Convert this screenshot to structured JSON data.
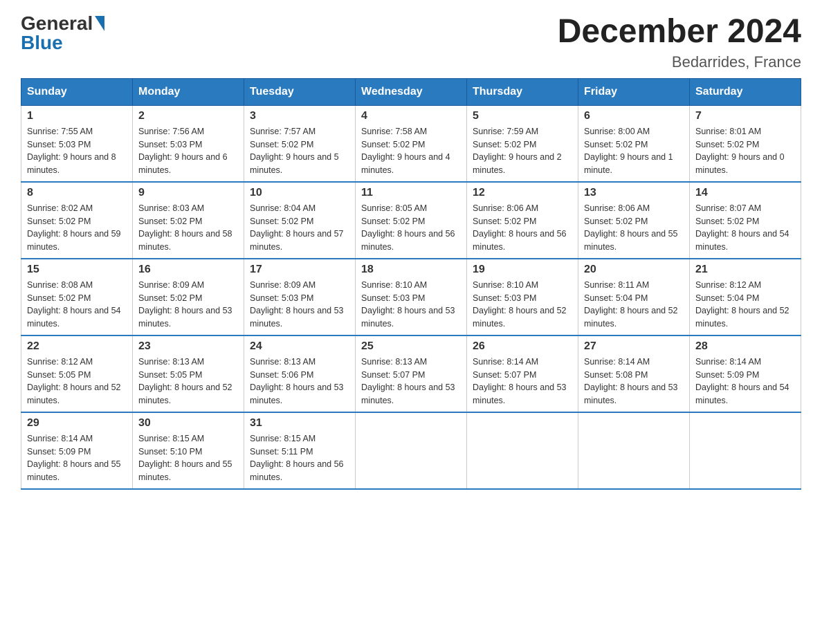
{
  "header": {
    "logo_general": "General",
    "logo_blue": "Blue",
    "month_title": "December 2024",
    "location": "Bedarrides, France"
  },
  "weekdays": [
    "Sunday",
    "Monday",
    "Tuesday",
    "Wednesday",
    "Thursday",
    "Friday",
    "Saturday"
  ],
  "weeks": [
    [
      {
        "day": "1",
        "sunrise": "Sunrise: 7:55 AM",
        "sunset": "Sunset: 5:03 PM",
        "daylight": "Daylight: 9 hours and 8 minutes."
      },
      {
        "day": "2",
        "sunrise": "Sunrise: 7:56 AM",
        "sunset": "Sunset: 5:03 PM",
        "daylight": "Daylight: 9 hours and 6 minutes."
      },
      {
        "day": "3",
        "sunrise": "Sunrise: 7:57 AM",
        "sunset": "Sunset: 5:02 PM",
        "daylight": "Daylight: 9 hours and 5 minutes."
      },
      {
        "day": "4",
        "sunrise": "Sunrise: 7:58 AM",
        "sunset": "Sunset: 5:02 PM",
        "daylight": "Daylight: 9 hours and 4 minutes."
      },
      {
        "day": "5",
        "sunrise": "Sunrise: 7:59 AM",
        "sunset": "Sunset: 5:02 PM",
        "daylight": "Daylight: 9 hours and 2 minutes."
      },
      {
        "day": "6",
        "sunrise": "Sunrise: 8:00 AM",
        "sunset": "Sunset: 5:02 PM",
        "daylight": "Daylight: 9 hours and 1 minute."
      },
      {
        "day": "7",
        "sunrise": "Sunrise: 8:01 AM",
        "sunset": "Sunset: 5:02 PM",
        "daylight": "Daylight: 9 hours and 0 minutes."
      }
    ],
    [
      {
        "day": "8",
        "sunrise": "Sunrise: 8:02 AM",
        "sunset": "Sunset: 5:02 PM",
        "daylight": "Daylight: 8 hours and 59 minutes."
      },
      {
        "day": "9",
        "sunrise": "Sunrise: 8:03 AM",
        "sunset": "Sunset: 5:02 PM",
        "daylight": "Daylight: 8 hours and 58 minutes."
      },
      {
        "day": "10",
        "sunrise": "Sunrise: 8:04 AM",
        "sunset": "Sunset: 5:02 PM",
        "daylight": "Daylight: 8 hours and 57 minutes."
      },
      {
        "day": "11",
        "sunrise": "Sunrise: 8:05 AM",
        "sunset": "Sunset: 5:02 PM",
        "daylight": "Daylight: 8 hours and 56 minutes."
      },
      {
        "day": "12",
        "sunrise": "Sunrise: 8:06 AM",
        "sunset": "Sunset: 5:02 PM",
        "daylight": "Daylight: 8 hours and 56 minutes."
      },
      {
        "day": "13",
        "sunrise": "Sunrise: 8:06 AM",
        "sunset": "Sunset: 5:02 PM",
        "daylight": "Daylight: 8 hours and 55 minutes."
      },
      {
        "day": "14",
        "sunrise": "Sunrise: 8:07 AM",
        "sunset": "Sunset: 5:02 PM",
        "daylight": "Daylight: 8 hours and 54 minutes."
      }
    ],
    [
      {
        "day": "15",
        "sunrise": "Sunrise: 8:08 AM",
        "sunset": "Sunset: 5:02 PM",
        "daylight": "Daylight: 8 hours and 54 minutes."
      },
      {
        "day": "16",
        "sunrise": "Sunrise: 8:09 AM",
        "sunset": "Sunset: 5:02 PM",
        "daylight": "Daylight: 8 hours and 53 minutes."
      },
      {
        "day": "17",
        "sunrise": "Sunrise: 8:09 AM",
        "sunset": "Sunset: 5:03 PM",
        "daylight": "Daylight: 8 hours and 53 minutes."
      },
      {
        "day": "18",
        "sunrise": "Sunrise: 8:10 AM",
        "sunset": "Sunset: 5:03 PM",
        "daylight": "Daylight: 8 hours and 53 minutes."
      },
      {
        "day": "19",
        "sunrise": "Sunrise: 8:10 AM",
        "sunset": "Sunset: 5:03 PM",
        "daylight": "Daylight: 8 hours and 52 minutes."
      },
      {
        "day": "20",
        "sunrise": "Sunrise: 8:11 AM",
        "sunset": "Sunset: 5:04 PM",
        "daylight": "Daylight: 8 hours and 52 minutes."
      },
      {
        "day": "21",
        "sunrise": "Sunrise: 8:12 AM",
        "sunset": "Sunset: 5:04 PM",
        "daylight": "Daylight: 8 hours and 52 minutes."
      }
    ],
    [
      {
        "day": "22",
        "sunrise": "Sunrise: 8:12 AM",
        "sunset": "Sunset: 5:05 PM",
        "daylight": "Daylight: 8 hours and 52 minutes."
      },
      {
        "day": "23",
        "sunrise": "Sunrise: 8:13 AM",
        "sunset": "Sunset: 5:05 PM",
        "daylight": "Daylight: 8 hours and 52 minutes."
      },
      {
        "day": "24",
        "sunrise": "Sunrise: 8:13 AM",
        "sunset": "Sunset: 5:06 PM",
        "daylight": "Daylight: 8 hours and 53 minutes."
      },
      {
        "day": "25",
        "sunrise": "Sunrise: 8:13 AM",
        "sunset": "Sunset: 5:07 PM",
        "daylight": "Daylight: 8 hours and 53 minutes."
      },
      {
        "day": "26",
        "sunrise": "Sunrise: 8:14 AM",
        "sunset": "Sunset: 5:07 PM",
        "daylight": "Daylight: 8 hours and 53 minutes."
      },
      {
        "day": "27",
        "sunrise": "Sunrise: 8:14 AM",
        "sunset": "Sunset: 5:08 PM",
        "daylight": "Daylight: 8 hours and 53 minutes."
      },
      {
        "day": "28",
        "sunrise": "Sunrise: 8:14 AM",
        "sunset": "Sunset: 5:09 PM",
        "daylight": "Daylight: 8 hours and 54 minutes."
      }
    ],
    [
      {
        "day": "29",
        "sunrise": "Sunrise: 8:14 AM",
        "sunset": "Sunset: 5:09 PM",
        "daylight": "Daylight: 8 hours and 55 minutes."
      },
      {
        "day": "30",
        "sunrise": "Sunrise: 8:15 AM",
        "sunset": "Sunset: 5:10 PM",
        "daylight": "Daylight: 8 hours and 55 minutes."
      },
      {
        "day": "31",
        "sunrise": "Sunrise: 8:15 AM",
        "sunset": "Sunset: 5:11 PM",
        "daylight": "Daylight: 8 hours and 56 minutes."
      },
      null,
      null,
      null,
      null
    ]
  ]
}
